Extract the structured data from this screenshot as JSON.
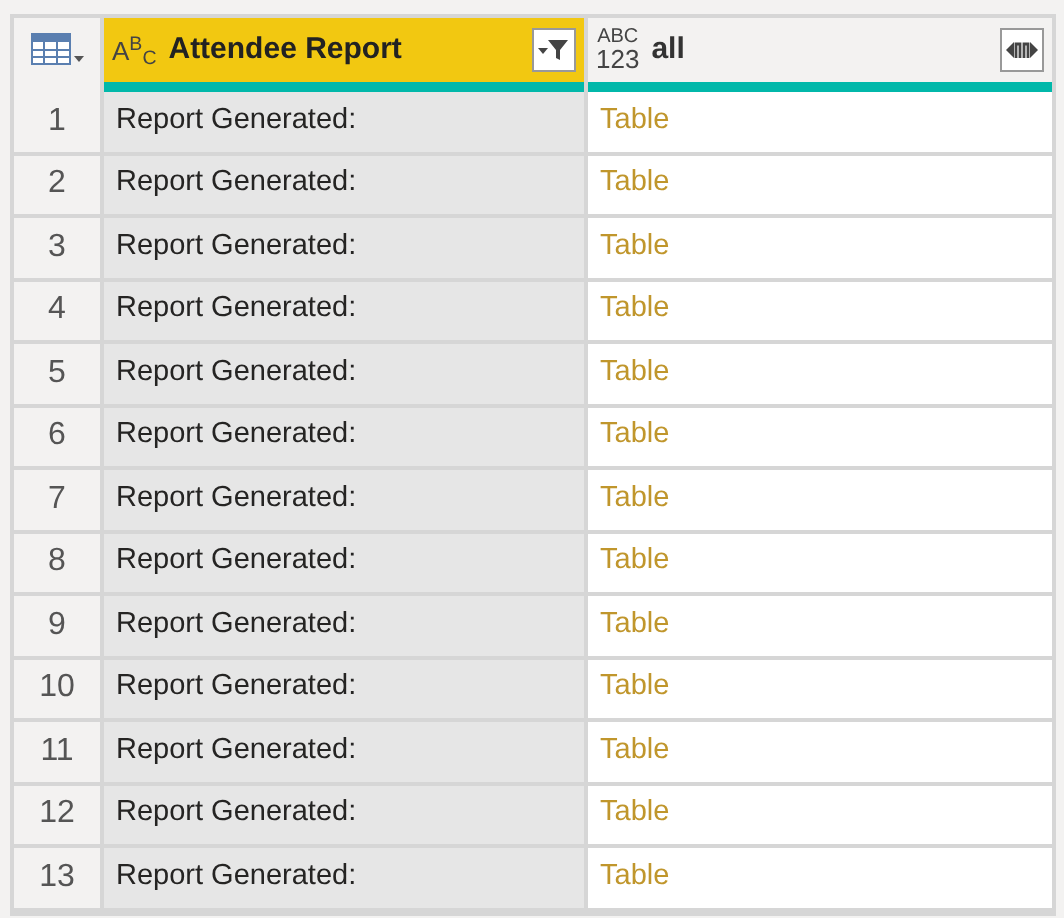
{
  "columns": [
    {
      "name": "Attendee Report",
      "kind": "text",
      "selected": true,
      "type_label": [
        "A$^{B}$$_{C}$"
      ]
    },
    {
      "name": "all",
      "kind": "any",
      "selected": false,
      "type_label": [
        "ABC",
        "123"
      ]
    }
  ],
  "rows": [
    {
      "number": "1",
      "cells": [
        "Report Generated:",
        "Table"
      ]
    },
    {
      "number": "2",
      "cells": [
        "Report Generated:",
        "Table"
      ]
    },
    {
      "number": "3",
      "cells": [
        "Report Generated:",
        "Table"
      ]
    },
    {
      "number": "4",
      "cells": [
        "Report Generated:",
        "Table"
      ]
    },
    {
      "number": "5",
      "cells": [
        "Report Generated:",
        "Table"
      ]
    },
    {
      "number": "6",
      "cells": [
        "Report Generated:",
        "Table"
      ]
    },
    {
      "number": "7",
      "cells": [
        "Report Generated:",
        "Table"
      ]
    },
    {
      "number": "8",
      "cells": [
        "Report Generated:",
        "Table"
      ]
    },
    {
      "number": "9",
      "cells": [
        "Report Generated:",
        "Table"
      ]
    },
    {
      "number": "10",
      "cells": [
        "Report Generated:",
        "Table"
      ]
    },
    {
      "number": "11",
      "cells": [
        "Report Generated:",
        "Table"
      ]
    },
    {
      "number": "12",
      "cells": [
        "Report Generated:",
        "Table"
      ]
    },
    {
      "number": "13",
      "cells": [
        "Report Generated:",
        "Table"
      ]
    }
  ]
}
